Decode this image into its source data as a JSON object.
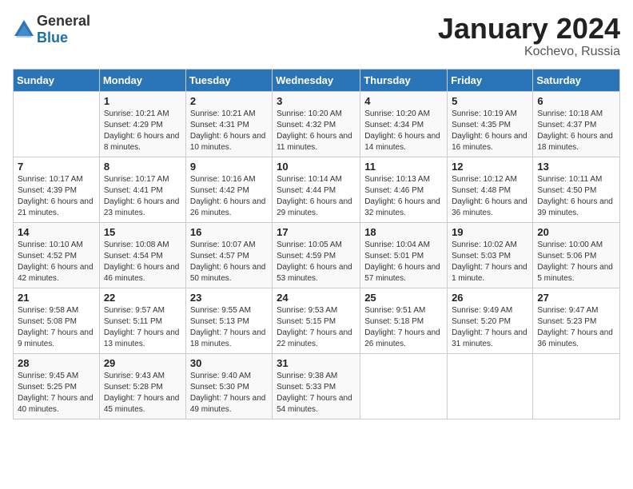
{
  "logo": {
    "general": "General",
    "blue": "Blue"
  },
  "header": {
    "month": "January 2024",
    "location": "Kochevo, Russia"
  },
  "weekdays": [
    "Sunday",
    "Monday",
    "Tuesday",
    "Wednesday",
    "Thursday",
    "Friday",
    "Saturday"
  ],
  "weeks": [
    [
      {
        "day": "",
        "sunrise": "",
        "sunset": "",
        "daylight": ""
      },
      {
        "day": "1",
        "sunrise": "Sunrise: 10:21 AM",
        "sunset": "Sunset: 4:29 PM",
        "daylight": "Daylight: 6 hours and 8 minutes."
      },
      {
        "day": "2",
        "sunrise": "Sunrise: 10:21 AM",
        "sunset": "Sunset: 4:31 PM",
        "daylight": "Daylight: 6 hours and 10 minutes."
      },
      {
        "day": "3",
        "sunrise": "Sunrise: 10:20 AM",
        "sunset": "Sunset: 4:32 PM",
        "daylight": "Daylight: 6 hours and 11 minutes."
      },
      {
        "day": "4",
        "sunrise": "Sunrise: 10:20 AM",
        "sunset": "Sunset: 4:34 PM",
        "daylight": "Daylight: 6 hours and 14 minutes."
      },
      {
        "day": "5",
        "sunrise": "Sunrise: 10:19 AM",
        "sunset": "Sunset: 4:35 PM",
        "daylight": "Daylight: 6 hours and 16 minutes."
      },
      {
        "day": "6",
        "sunrise": "Sunrise: 10:18 AM",
        "sunset": "Sunset: 4:37 PM",
        "daylight": "Daylight: 6 hours and 18 minutes."
      }
    ],
    [
      {
        "day": "7",
        "sunrise": "Sunrise: 10:17 AM",
        "sunset": "Sunset: 4:39 PM",
        "daylight": "Daylight: 6 hours and 21 minutes."
      },
      {
        "day": "8",
        "sunrise": "Sunrise: 10:17 AM",
        "sunset": "Sunset: 4:41 PM",
        "daylight": "Daylight: 6 hours and 23 minutes."
      },
      {
        "day": "9",
        "sunrise": "Sunrise: 10:16 AM",
        "sunset": "Sunset: 4:42 PM",
        "daylight": "Daylight: 6 hours and 26 minutes."
      },
      {
        "day": "10",
        "sunrise": "Sunrise: 10:14 AM",
        "sunset": "Sunset: 4:44 PM",
        "daylight": "Daylight: 6 hours and 29 minutes."
      },
      {
        "day": "11",
        "sunrise": "Sunrise: 10:13 AM",
        "sunset": "Sunset: 4:46 PM",
        "daylight": "Daylight: 6 hours and 32 minutes."
      },
      {
        "day": "12",
        "sunrise": "Sunrise: 10:12 AM",
        "sunset": "Sunset: 4:48 PM",
        "daylight": "Daylight: 6 hours and 36 minutes."
      },
      {
        "day": "13",
        "sunrise": "Sunrise: 10:11 AM",
        "sunset": "Sunset: 4:50 PM",
        "daylight": "Daylight: 6 hours and 39 minutes."
      }
    ],
    [
      {
        "day": "14",
        "sunrise": "Sunrise: 10:10 AM",
        "sunset": "Sunset: 4:52 PM",
        "daylight": "Daylight: 6 hours and 42 minutes."
      },
      {
        "day": "15",
        "sunrise": "Sunrise: 10:08 AM",
        "sunset": "Sunset: 4:54 PM",
        "daylight": "Daylight: 6 hours and 46 minutes."
      },
      {
        "day": "16",
        "sunrise": "Sunrise: 10:07 AM",
        "sunset": "Sunset: 4:57 PM",
        "daylight": "Daylight: 6 hours and 50 minutes."
      },
      {
        "day": "17",
        "sunrise": "Sunrise: 10:05 AM",
        "sunset": "Sunset: 4:59 PM",
        "daylight": "Daylight: 6 hours and 53 minutes."
      },
      {
        "day": "18",
        "sunrise": "Sunrise: 10:04 AM",
        "sunset": "Sunset: 5:01 PM",
        "daylight": "Daylight: 6 hours and 57 minutes."
      },
      {
        "day": "19",
        "sunrise": "Sunrise: 10:02 AM",
        "sunset": "Sunset: 5:03 PM",
        "daylight": "Daylight: 7 hours and 1 minute."
      },
      {
        "day": "20",
        "sunrise": "Sunrise: 10:00 AM",
        "sunset": "Sunset: 5:06 PM",
        "daylight": "Daylight: 7 hours and 5 minutes."
      }
    ],
    [
      {
        "day": "21",
        "sunrise": "Sunrise: 9:58 AM",
        "sunset": "Sunset: 5:08 PM",
        "daylight": "Daylight: 7 hours and 9 minutes."
      },
      {
        "day": "22",
        "sunrise": "Sunrise: 9:57 AM",
        "sunset": "Sunset: 5:11 PM",
        "daylight": "Daylight: 7 hours and 13 minutes."
      },
      {
        "day": "23",
        "sunrise": "Sunrise: 9:55 AM",
        "sunset": "Sunset: 5:13 PM",
        "daylight": "Daylight: 7 hours and 18 minutes."
      },
      {
        "day": "24",
        "sunrise": "Sunrise: 9:53 AM",
        "sunset": "Sunset: 5:15 PM",
        "daylight": "Daylight: 7 hours and 22 minutes."
      },
      {
        "day": "25",
        "sunrise": "Sunrise: 9:51 AM",
        "sunset": "Sunset: 5:18 PM",
        "daylight": "Daylight: 7 hours and 26 minutes."
      },
      {
        "day": "26",
        "sunrise": "Sunrise: 9:49 AM",
        "sunset": "Sunset: 5:20 PM",
        "daylight": "Daylight: 7 hours and 31 minutes."
      },
      {
        "day": "27",
        "sunrise": "Sunrise: 9:47 AM",
        "sunset": "Sunset: 5:23 PM",
        "daylight": "Daylight: 7 hours and 36 minutes."
      }
    ],
    [
      {
        "day": "28",
        "sunrise": "Sunrise: 9:45 AM",
        "sunset": "Sunset: 5:25 PM",
        "daylight": "Daylight: 7 hours and 40 minutes."
      },
      {
        "day": "29",
        "sunrise": "Sunrise: 9:43 AM",
        "sunset": "Sunset: 5:28 PM",
        "daylight": "Daylight: 7 hours and 45 minutes."
      },
      {
        "day": "30",
        "sunrise": "Sunrise: 9:40 AM",
        "sunset": "Sunset: 5:30 PM",
        "daylight": "Daylight: 7 hours and 49 minutes."
      },
      {
        "day": "31",
        "sunrise": "Sunrise: 9:38 AM",
        "sunset": "Sunset: 5:33 PM",
        "daylight": "Daylight: 7 hours and 54 minutes."
      },
      {
        "day": "",
        "sunrise": "",
        "sunset": "",
        "daylight": ""
      },
      {
        "day": "",
        "sunrise": "",
        "sunset": "",
        "daylight": ""
      },
      {
        "day": "",
        "sunrise": "",
        "sunset": "",
        "daylight": ""
      }
    ]
  ]
}
